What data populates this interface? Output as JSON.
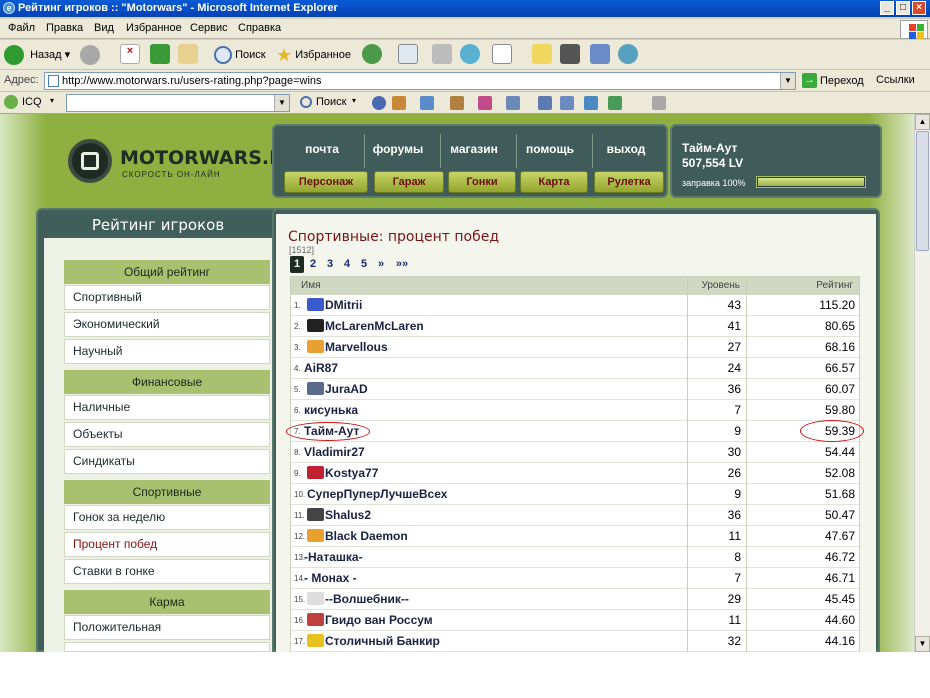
{
  "window": {
    "title": "Рейтинг игроков :: \"Motorwars\" - Microsoft Internet Explorer"
  },
  "menu": [
    "Файл",
    "Правка",
    "Вид",
    "Избранное",
    "Сервис",
    "Справка"
  ],
  "toolbar": {
    "back": "Назад",
    "search": "Поиск",
    "favorites": "Избранное"
  },
  "address": {
    "label": "Адрес:",
    "url": "http://www.motorwars.ru/users-rating.php?page=wins",
    "go": "Переход",
    "links": "Ссылки"
  },
  "icq": {
    "label": "ICQ",
    "search": "Поиск"
  },
  "site": {
    "logo": "MOTORWARS.RU",
    "logo_sub": "СКОРОСТЬ ОН-ЛАЙН",
    "nav_top": [
      "почта",
      "форумы",
      "магазин",
      "помощь",
      "выход"
    ],
    "nav_buttons": [
      "Персонаж",
      "Гараж",
      "Гонки",
      "Карта",
      "Рулетка"
    ],
    "user": {
      "name": "Тайм-Аут",
      "money": "507,554 LV",
      "fuel_label": "заправка 100%",
      "fuel_fraction": 1.0
    }
  },
  "sidebar": {
    "title": "Рейтинг игроков",
    "groups": [
      {
        "title": "Общий рейтинг",
        "items": [
          "Спортивный",
          "Экономический",
          "Научный"
        ]
      },
      {
        "title": "Финансовые",
        "items": [
          "Наличные",
          "Объекты",
          "Синдикаты"
        ]
      },
      {
        "title": "Спортивные",
        "items": [
          "Гонок за неделю",
          "Процент побед",
          "Ставки в гонке"
        ]
      },
      {
        "title": "Карма",
        "items": [
          "Положительная"
        ]
      }
    ],
    "active": "Процент побед"
  },
  "main": {
    "title": "Спортивные: процент побед",
    "count": "[1512]",
    "pages": [
      "1",
      "2",
      "3",
      "4",
      "5",
      "»",
      "»»"
    ],
    "columns": {
      "name": "Имя",
      "level": "Уровень",
      "rating": "Рейтинг"
    },
    "rows": [
      {
        "n": "1.",
        "name": "DMitrii",
        "level": "43",
        "rating": "115.20",
        "flag": "#3a5ad0"
      },
      {
        "n": "2.",
        "name": "McLarenMcLaren",
        "level": "41",
        "rating": "80.65",
        "flag": "#222222"
      },
      {
        "n": "3.",
        "name": "Marvellous",
        "level": "27",
        "rating": "68.16",
        "flag": "#e8a030"
      },
      {
        "n": "4.",
        "name": "AiR87",
        "level": "24",
        "rating": "66.57",
        "flag": ""
      },
      {
        "n": "5.",
        "name": "JuraAD",
        "level": "36",
        "rating": "60.07",
        "flag": "#5a6a8a"
      },
      {
        "n": "6.",
        "name": "кисунька",
        "level": "7",
        "rating": "59.80",
        "flag": ""
      },
      {
        "n": "7.",
        "name": "Тайм-Аут",
        "level": "9",
        "rating": "59.39",
        "flag": ""
      },
      {
        "n": "8.",
        "name": "Vladimir27",
        "level": "30",
        "rating": "54.44",
        "flag": ""
      },
      {
        "n": "9.",
        "name": "Kostya77",
        "level": "26",
        "rating": "52.08",
        "flag": "#c02030"
      },
      {
        "n": "10.",
        "name": "СуперПуперЛучшеВсех",
        "level": "9",
        "rating": "51.68",
        "flag": ""
      },
      {
        "n": "11.",
        "name": "Shalus2",
        "level": "36",
        "rating": "50.47",
        "flag": "#444444"
      },
      {
        "n": "12.",
        "name": "Black Daemon",
        "level": "11",
        "rating": "47.67",
        "flag": "#e8a030"
      },
      {
        "n": "13.",
        "name": "-Наташка-",
        "level": "8",
        "rating": "46.72",
        "flag": ""
      },
      {
        "n": "14.",
        "name": "- Монах -",
        "level": "7",
        "rating": "46.71",
        "flag": ""
      },
      {
        "n": "15.",
        "name": "--Волшебник--",
        "level": "29",
        "rating": "45.45",
        "flag": "#dddddd"
      },
      {
        "n": "16.",
        "name": "Гвидо ван Россум",
        "level": "11",
        "rating": "44.60",
        "flag": "#c04040"
      },
      {
        "n": "17.",
        "name": "Столичный Банкир",
        "level": "32",
        "rating": "44.16",
        "flag": "#e8c020"
      }
    ]
  }
}
